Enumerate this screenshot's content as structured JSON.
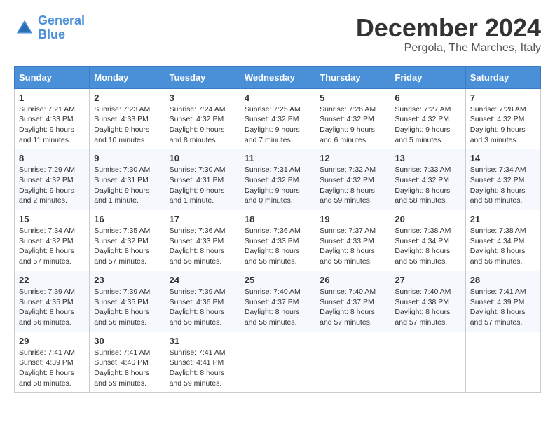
{
  "header": {
    "logo_line1": "General",
    "logo_line2": "Blue",
    "title": "December 2024",
    "subtitle": "Pergola, The Marches, Italy"
  },
  "columns": [
    "Sunday",
    "Monday",
    "Tuesday",
    "Wednesday",
    "Thursday",
    "Friday",
    "Saturday"
  ],
  "weeks": [
    [
      {
        "day": "1",
        "info": "Sunrise: 7:21 AM\nSunset: 4:33 PM\nDaylight: 9 hours\nand 11 minutes."
      },
      {
        "day": "2",
        "info": "Sunrise: 7:23 AM\nSunset: 4:33 PM\nDaylight: 9 hours\nand 10 minutes."
      },
      {
        "day": "3",
        "info": "Sunrise: 7:24 AM\nSunset: 4:32 PM\nDaylight: 9 hours\nand 8 minutes."
      },
      {
        "day": "4",
        "info": "Sunrise: 7:25 AM\nSunset: 4:32 PM\nDaylight: 9 hours\nand 7 minutes."
      },
      {
        "day": "5",
        "info": "Sunrise: 7:26 AM\nSunset: 4:32 PM\nDaylight: 9 hours\nand 6 minutes."
      },
      {
        "day": "6",
        "info": "Sunrise: 7:27 AM\nSunset: 4:32 PM\nDaylight: 9 hours\nand 5 minutes."
      },
      {
        "day": "7",
        "info": "Sunrise: 7:28 AM\nSunset: 4:32 PM\nDaylight: 9 hours\nand 3 minutes."
      }
    ],
    [
      {
        "day": "8",
        "info": "Sunrise: 7:29 AM\nSunset: 4:32 PM\nDaylight: 9 hours\nand 2 minutes."
      },
      {
        "day": "9",
        "info": "Sunrise: 7:30 AM\nSunset: 4:31 PM\nDaylight: 9 hours\nand 1 minute."
      },
      {
        "day": "10",
        "info": "Sunrise: 7:30 AM\nSunset: 4:31 PM\nDaylight: 9 hours\nand 1 minute."
      },
      {
        "day": "11",
        "info": "Sunrise: 7:31 AM\nSunset: 4:32 PM\nDaylight: 9 hours\nand 0 minutes."
      },
      {
        "day": "12",
        "info": "Sunrise: 7:32 AM\nSunset: 4:32 PM\nDaylight: 8 hours\nand 59 minutes."
      },
      {
        "day": "13",
        "info": "Sunrise: 7:33 AM\nSunset: 4:32 PM\nDaylight: 8 hours\nand 58 minutes."
      },
      {
        "day": "14",
        "info": "Sunrise: 7:34 AM\nSunset: 4:32 PM\nDaylight: 8 hours\nand 58 minutes."
      }
    ],
    [
      {
        "day": "15",
        "info": "Sunrise: 7:34 AM\nSunset: 4:32 PM\nDaylight: 8 hours\nand 57 minutes."
      },
      {
        "day": "16",
        "info": "Sunrise: 7:35 AM\nSunset: 4:32 PM\nDaylight: 8 hours\nand 57 minutes."
      },
      {
        "day": "17",
        "info": "Sunrise: 7:36 AM\nSunset: 4:33 PM\nDaylight: 8 hours\nand 56 minutes."
      },
      {
        "day": "18",
        "info": "Sunrise: 7:36 AM\nSunset: 4:33 PM\nDaylight: 8 hours\nand 56 minutes."
      },
      {
        "day": "19",
        "info": "Sunrise: 7:37 AM\nSunset: 4:33 PM\nDaylight: 8 hours\nand 56 minutes."
      },
      {
        "day": "20",
        "info": "Sunrise: 7:38 AM\nSunset: 4:34 PM\nDaylight: 8 hours\nand 56 minutes."
      },
      {
        "day": "21",
        "info": "Sunrise: 7:38 AM\nSunset: 4:34 PM\nDaylight: 8 hours\nand 56 minutes."
      }
    ],
    [
      {
        "day": "22",
        "info": "Sunrise: 7:39 AM\nSunset: 4:35 PM\nDaylight: 8 hours\nand 56 minutes."
      },
      {
        "day": "23",
        "info": "Sunrise: 7:39 AM\nSunset: 4:35 PM\nDaylight: 8 hours\nand 56 minutes."
      },
      {
        "day": "24",
        "info": "Sunrise: 7:39 AM\nSunset: 4:36 PM\nDaylight: 8 hours\nand 56 minutes."
      },
      {
        "day": "25",
        "info": "Sunrise: 7:40 AM\nSunset: 4:37 PM\nDaylight: 8 hours\nand 56 minutes."
      },
      {
        "day": "26",
        "info": "Sunrise: 7:40 AM\nSunset: 4:37 PM\nDaylight: 8 hours\nand 57 minutes."
      },
      {
        "day": "27",
        "info": "Sunrise: 7:40 AM\nSunset: 4:38 PM\nDaylight: 8 hours\nand 57 minutes."
      },
      {
        "day": "28",
        "info": "Sunrise: 7:41 AM\nSunset: 4:39 PM\nDaylight: 8 hours\nand 57 minutes."
      }
    ],
    [
      {
        "day": "29",
        "info": "Sunrise: 7:41 AM\nSunset: 4:39 PM\nDaylight: 8 hours\nand 58 minutes."
      },
      {
        "day": "30",
        "info": "Sunrise: 7:41 AM\nSunset: 4:40 PM\nDaylight: 8 hours\nand 59 minutes."
      },
      {
        "day": "31",
        "info": "Sunrise: 7:41 AM\nSunset: 4:41 PM\nDaylight: 8 hours\nand 59 minutes."
      },
      null,
      null,
      null,
      null
    ]
  ]
}
